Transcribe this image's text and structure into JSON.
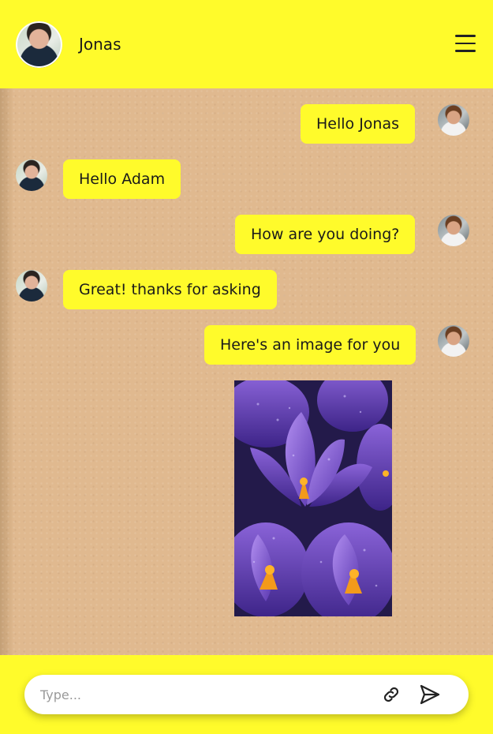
{
  "header": {
    "contact_name": "Jonas",
    "avatar_icon": "contact-avatar",
    "menu_icon": "hamburger-menu-icon"
  },
  "messages": [
    {
      "sender": "Adam",
      "text": "Hello Jonas"
    },
    {
      "sender": "Jonas",
      "text": "Hello Adam"
    },
    {
      "sender": "Adam",
      "text": "How are you doing?"
    },
    {
      "sender": "Jonas",
      "text": "Great! thanks for asking"
    },
    {
      "sender": "Adam",
      "text": "Here's an image for you"
    }
  ],
  "attachment": {
    "type": "image",
    "description_icon": "purple-crocus-flowers-photo"
  },
  "composer": {
    "placeholder": "Type...",
    "value": "",
    "attach_icon": "link-icon",
    "send_icon": "send-icon"
  },
  "colors": {
    "accent": "#fffb2b",
    "background": "#e0b98f"
  }
}
